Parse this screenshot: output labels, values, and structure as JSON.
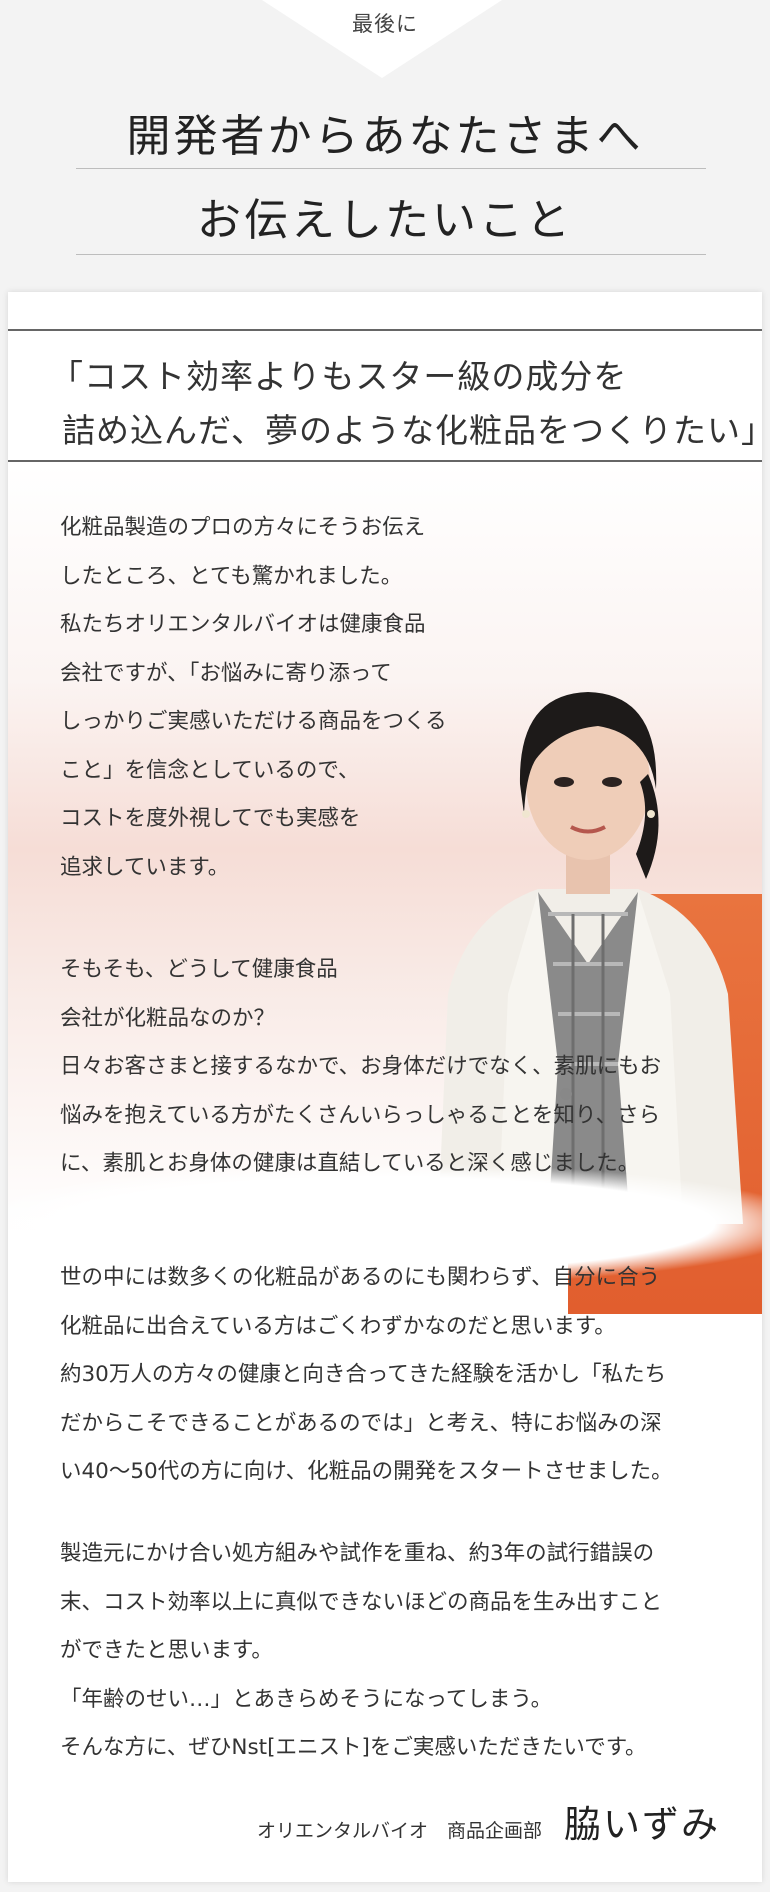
{
  "header": {
    "label": "最後に",
    "title_line1": "開発者からあなたさまへ",
    "title_line2": "お伝えしたいこと"
  },
  "quote": {
    "line1": "「コスト効率よりもスター級の成分を",
    "line2": "詰め込んだ、夢のような化粧品をつくりたい」"
  },
  "paragraphs": [
    [
      "化粧品製造のプロの方々にそうお伝え",
      "したところ、とても驚かれました。",
      "私たちオリエンタルバイオは健康食品",
      "会社ですが、「お悩みに寄り添って",
      "しっかりご実感いただける商品をつくる",
      "こと」を信念としているので、",
      "コストを度外視してでも実感を",
      "追求しています。"
    ],
    [
      "そもそも、どうして健康食品",
      "会社が化粧品なのか？",
      "日々お客さまと接するなかで、お身体だけでなく、素肌にもお",
      "悩みを抱えている方がたくさんいらっしゃることを知り、さら",
      "に、素肌とお身体の健康は直結していると深く感じました。"
    ],
    [
      "世の中には数多くの化粧品があるのにも関わらず、自分に合う",
      "化粧品に出合えている方はごくわずかなのだと思います。",
      "約30万人の方々の健康と向き合ってきた経験を活かし「私たち",
      "だからこそできることがあるのでは」と考え、特にお悩みの深",
      "い40〜50代の方に向け、化粧品の開発をスタートさせました。"
    ],
    [
      "製造元にかけ合い処方組みや試作を重ね、約3年の試行錯誤の",
      "末、コスト効率以上に真似できないほどの商品を生み出すこと",
      "ができたと思います。",
      "「年齢のせい…」とあきらめそうになってしまう。",
      "そんな方に、ぜひNst[エニスト]をご実感いただきたいです。"
    ]
  ],
  "signature": {
    "department": "オリエンタルバイオ　商品企画部",
    "name": "脇いずみ"
  },
  "colors": {
    "accent_orange": "#e4643a",
    "header_bg": "#f3f3f3"
  }
}
